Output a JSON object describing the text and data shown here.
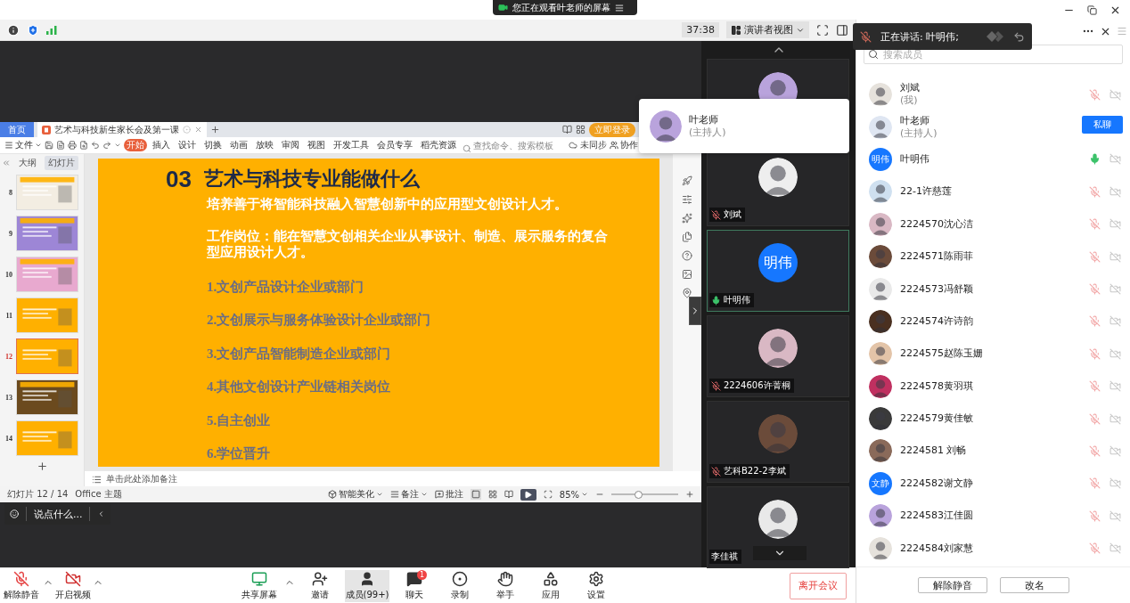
{
  "screen_banner": {
    "text": "您正在观看叶老师的屏幕"
  },
  "meeting_toolbar": {
    "timer": "37:38",
    "view_button": "演讲者视图"
  },
  "speaker_notice": {
    "text": "正在讲话: 叶明伟;"
  },
  "shared_screen": {
    "tabs": [
      {
        "kind": "home",
        "label": "首页",
        "selected": false
      },
      {
        "kind": "document",
        "label": "艺术与科技新生家长会及第一课",
        "selected": true
      }
    ],
    "login_button": "立即登录",
    "file_menu": "文件",
    "ribbon_tabs": [
      {
        "label": "开始",
        "selected": true
      },
      {
        "label": "插入",
        "selected": false
      },
      {
        "label": "设计",
        "selected": false
      },
      {
        "label": "切换",
        "selected": false
      },
      {
        "label": "动画",
        "selected": false
      },
      {
        "label": "放映",
        "selected": false
      },
      {
        "label": "审阅",
        "selected": false
      },
      {
        "label": "视图",
        "selected": false
      },
      {
        "label": "开发工具",
        "selected": false
      },
      {
        "label": "会员专享",
        "selected": false
      },
      {
        "label": "稻壳资源",
        "selected": false
      }
    ],
    "search": {
      "placeholder": "查找命令、搜索模板"
    },
    "sync_status": "未同步",
    "collaborate": "协作",
    "panel_tabs": [
      {
        "label": "大纲",
        "selected": false
      },
      {
        "label": "幻灯片",
        "selected": true
      }
    ],
    "thumbnails": [
      {
        "number": "8",
        "selected": false,
        "color": "#f3ede2"
      },
      {
        "number": "9",
        "selected": false,
        "color": "#9d86d6"
      },
      {
        "number": "10",
        "selected": false,
        "color": "#e8a9cf"
      },
      {
        "number": "11",
        "selected": false,
        "color": "#ffb000"
      },
      {
        "number": "12",
        "selected": true,
        "color": "#ffb000"
      },
      {
        "number": "13",
        "selected": false,
        "color": "#6b4a1e"
      },
      {
        "number": "14",
        "selected": false,
        "color": "#ffb000"
      }
    ],
    "slide": {
      "number": "03",
      "title": "艺术与科技专业能做什么",
      "subtitle": "培养善于将智能科技融入智慧创新中的应用型文创设计人才。",
      "description": "工作岗位：能在智慧文创相关企业从事设计、制造、展示服务的复合型应用设计人才。",
      "items": [
        "1.文创产品设计企业或部门",
        "2.文创展示与服务体验设计企业或部门",
        "3.文创产品智能制造企业或部门",
        "4.其他文创设计产业链相关岗位",
        "5.自主创业",
        "6.学位晋升"
      ]
    },
    "notes": {
      "text": "单击此处添加备注"
    },
    "status_bar": {
      "slide_count": "幻灯片 12 / 14",
      "theme": "Office 主题",
      "beautify": "智能美化",
      "notes": "备注",
      "comments": "批注",
      "zoom": "85%",
      "zoom_slider": {
        "level": 0.41
      }
    }
  },
  "chat_prompt": {
    "text": "说点什么..."
  },
  "video_tiles": [
    {
      "active": false
    },
    {
      "name": "刘斌",
      "muted": true,
      "active": false
    },
    {
      "name": "叶明伟",
      "avatar": {
        "kind": "text",
        "text": "明伟"
      },
      "muted": false,
      "active": true
    },
    {
      "name": "2224606许菁桐",
      "muted": true,
      "active": false
    },
    {
      "name": "艺科B22-2李斌",
      "muted": true,
      "active": false
    },
    {
      "name": "李佳祺",
      "active": false
    }
  ],
  "host_card": {
    "name": "叶老师",
    "role": "(主持人)"
  },
  "member_panel": {
    "search": {
      "placeholder": "搜索成员"
    },
    "members": [
      {
        "name": "刘斌",
        "note": "(我)",
        "muted": true
      },
      {
        "name": "叶老师",
        "note": "(主持人)",
        "action": "私聊"
      },
      {
        "name": "叶明伟",
        "avatar": {
          "kind": "text",
          "text": "明伟"
        },
        "muted": false
      },
      {
        "name": "22-1许慈莲",
        "muted": true
      },
      {
        "name": "2224570沈心洁",
        "muted": true
      },
      {
        "name": "2224571陈雨菲",
        "muted": true
      },
      {
        "name": "2224573冯舒颖",
        "muted": true
      },
      {
        "name": "2224574许诗韵",
        "muted": true
      },
      {
        "name": "2224575赵陈玉姗",
        "muted": true
      },
      {
        "name": "2224578黄羽琪",
        "muted": true
      },
      {
        "name": "2224579黄佳敏",
        "muted": true
      },
      {
        "name": "2224581 刘畅",
        "muted": true
      },
      {
        "name": "2224582谢文静",
        "avatar": {
          "kind": "text",
          "text": "文静"
        },
        "muted": true
      },
      {
        "name": "2224583江佳圆",
        "muted": true
      },
      {
        "name": "2224584刘家慧",
        "muted": true
      }
    ],
    "buttons": [
      "解除静音",
      "改名"
    ]
  },
  "controls": {
    "left": [
      {
        "kind": "mic-off",
        "label": "解除静音",
        "caret": true,
        "selected": false
      },
      {
        "kind": "video-off",
        "label": "开启视频",
        "caret": true,
        "selected": false
      }
    ],
    "center": [
      {
        "kind": "share",
        "label": "共享屏幕",
        "caret": true,
        "selected": false
      },
      {
        "kind": "invite",
        "label": "邀请",
        "caret": false,
        "selected": false
      },
      {
        "kind": "members",
        "label": "成员(99+)",
        "caret": false,
        "selected": true
      },
      {
        "kind": "chat",
        "label": "聊天",
        "caret": false,
        "selected": false,
        "badge": "1"
      },
      {
        "kind": "record",
        "label": "录制",
        "caret": false,
        "selected": false
      },
      {
        "kind": "hand",
        "label": "举手",
        "caret": false,
        "selected": false
      },
      {
        "kind": "apps",
        "label": "应用",
        "caret": false,
        "selected": false
      },
      {
        "kind": "settings",
        "label": "设置",
        "caret": false,
        "selected": false
      }
    ],
    "leave": "离开会议"
  }
}
